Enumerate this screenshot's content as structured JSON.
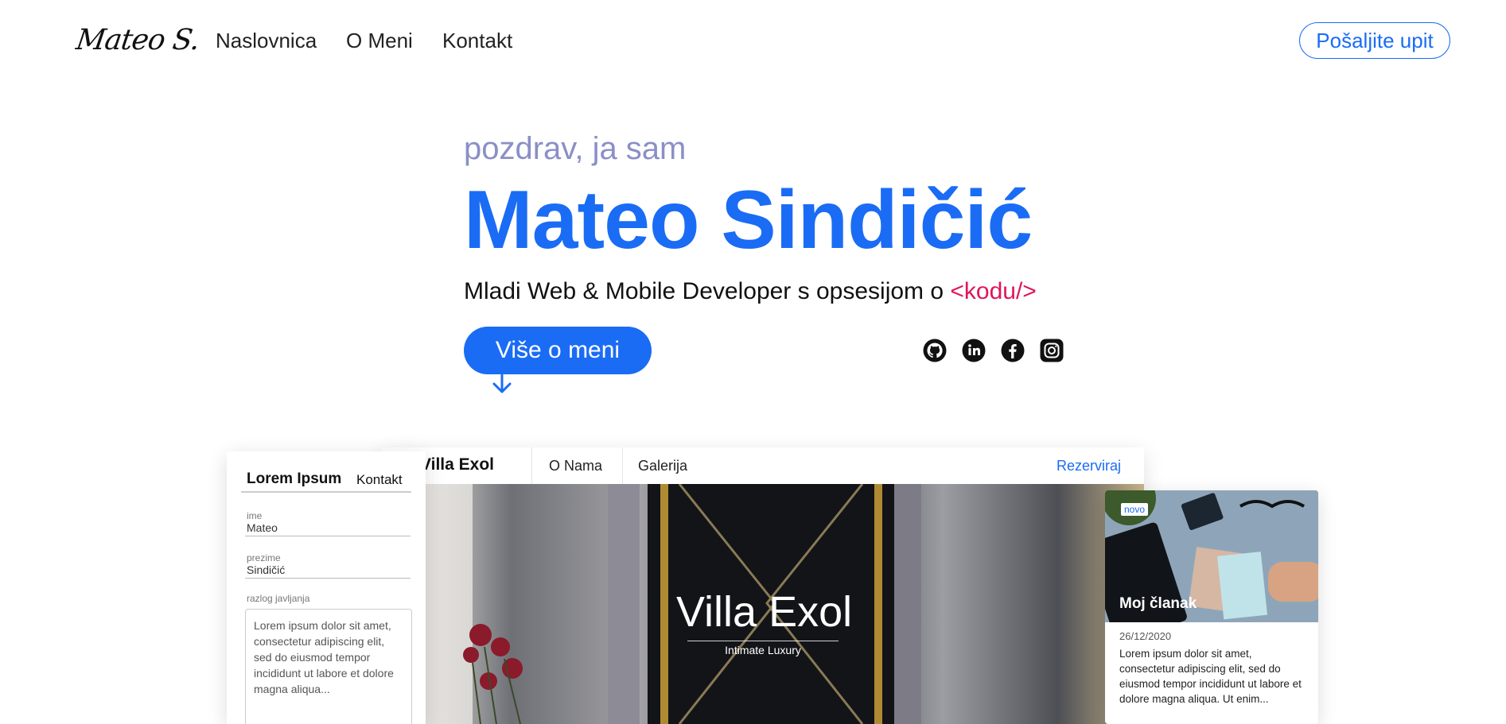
{
  "nav": {
    "logo": "Mateo S.",
    "links": [
      "Naslovnica",
      "O Meni",
      "Kontakt"
    ],
    "cta": "Pošaljite upit"
  },
  "hero": {
    "greeting": "pozdrav, ja sam",
    "name": "Mateo Sindičić",
    "tagline_prefix": "Mladi Web & Mobile Developer s opsesijom o ",
    "tagline_code": "<kodu/>",
    "button": "Više o meni",
    "social_icons": [
      "github-icon",
      "linkedin-icon",
      "facebook-icon",
      "instagram-icon"
    ]
  },
  "mock_hotel": {
    "brand": "Villa Exol",
    "links": [
      "O Nama",
      "Galerija"
    ],
    "cta": "Rezerviraj",
    "hero_title": "Villa Exol",
    "hero_subtitle": "Intimate Luxury"
  },
  "mock_form": {
    "title": "Lorem Ipsum",
    "link": "Kontakt",
    "fields": [
      {
        "label": "ime",
        "value": "Mateo"
      },
      {
        "label": "prezime",
        "value": "Sindičić"
      }
    ],
    "reason_label": "razlog javljanja",
    "reason_text": "Lorem ipsum dolor sit amet, consectetur adipiscing elit, sed do eiusmod tempor incididunt ut labore et dolore magna aliqua..."
  },
  "mock_card": {
    "badge": "novo",
    "title": "Moj članak",
    "date": "26/12/2020",
    "text": "Lorem ipsum dolor sit amet, consectetur adipiscing elit, sed do eiusmod tempor incididunt ut labore et dolore magna aliqua. Ut enim..."
  },
  "colors": {
    "accent": "#1a6cf5",
    "greeting": "#8a8fc7",
    "code": "#e0155b"
  }
}
